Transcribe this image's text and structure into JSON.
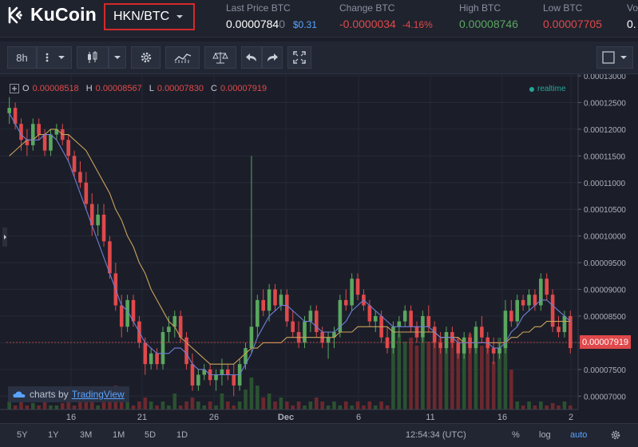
{
  "brand": {
    "name": "KuCoin"
  },
  "market": {
    "pair": "HKN/BTC"
  },
  "stats": {
    "last_price": {
      "label": "Last Price BTC",
      "value": "0.0000784",
      "value_faded": "0",
      "usd": "$0.31"
    },
    "change": {
      "label": "Change BTC",
      "value": "-0.0000034",
      "percent": "-4.16%"
    },
    "high": {
      "label": "High BTC",
      "value": "0.00008746"
    },
    "low": {
      "label": "Low BTC",
      "value": "0.00007705"
    },
    "volume": {
      "label": "Vo",
      "value": "0."
    }
  },
  "toolbar": {
    "interval": "8h"
  },
  "legend": {
    "o_label": "O",
    "o_value": "0.00008518",
    "h_label": "H",
    "h_value": "0.00008567",
    "l_label": "L",
    "l_value": "0.00007830",
    "c_label": "C",
    "c_value": "0.00007919",
    "realtime": "realtime"
  },
  "attribution": {
    "prefix": "charts by",
    "link": "TradingView"
  },
  "bottom": {
    "ranges": [
      "5Y",
      "1Y",
      "3M",
      "1M",
      "5D",
      "1D"
    ],
    "clock": "12:54:34 (UTC)",
    "percent": "%",
    "log": "log",
    "auto": "auto"
  },
  "colors": {
    "up": "#5aa75f",
    "down": "#e0494b",
    "accent": "#5aa3ff",
    "ma_fast": "#6f7fd6",
    "ma_slow": "#c9a25a"
  },
  "chart_data": {
    "type": "candlestick",
    "current_price": "0.00007919",
    "y_ticks": [
      "0.00013000",
      "0.00012500",
      "0.00012000",
      "0.00011500",
      "0.00011000",
      "0.00010500",
      "0.00010000",
      "0.00009500",
      "0.00009000",
      "0.00008500",
      "0.00008000",
      "0.00007500",
      "0.00007000"
    ],
    "ylim": [
      6.75e-05,
      0.0001303
    ],
    "x_ticks": [
      "16",
      "21",
      "26",
      "Dec",
      "6",
      "11",
      "16",
      "2"
    ],
    "candles": [
      [
        12.3,
        12.6,
        12.1,
        12.4
      ],
      [
        12.4,
        12.5,
        12.0,
        12.1
      ],
      [
        12.1,
        12.2,
        11.6,
        11.8
      ],
      [
        11.8,
        12.0,
        11.5,
        11.7
      ],
      [
        11.7,
        12.2,
        11.6,
        12.1
      ],
      [
        12.1,
        12.2,
        11.8,
        11.9
      ],
      [
        11.9,
        12.0,
        11.5,
        11.6
      ],
      [
        11.6,
        12.0,
        11.5,
        11.9
      ],
      [
        11.9,
        12.1,
        11.8,
        12.0
      ],
      [
        12.0,
        12.1,
        11.7,
        11.8
      ],
      [
        11.8,
        11.9,
        11.4,
        11.5
      ],
      [
        11.5,
        11.6,
        11.1,
        11.2
      ],
      [
        11.2,
        11.4,
        10.9,
        11.0
      ],
      [
        11.0,
        11.2,
        10.5,
        10.6
      ],
      [
        10.6,
        10.8,
        10.0,
        10.2
      ],
      [
        10.2,
        10.6,
        10.0,
        10.4
      ],
      [
        10.4,
        10.6,
        9.8,
        9.9
      ],
      [
        9.9,
        10.0,
        9.2,
        9.3
      ],
      [
        9.3,
        9.5,
        8.6,
        8.7
      ],
      [
        8.7,
        8.9,
        8.1,
        8.3
      ],
      [
        8.3,
        8.9,
        8.2,
        8.8
      ],
      [
        8.8,
        8.9,
        8.3,
        8.4
      ],
      [
        8.4,
        8.5,
        7.9,
        8.0
      ],
      [
        8.0,
        8.1,
        7.4,
        7.6
      ],
      [
        7.6,
        7.9,
        7.5,
        7.8
      ],
      [
        7.8,
        7.9,
        7.5,
        7.6
      ],
      [
        7.6,
        8.3,
        7.5,
        8.2
      ],
      [
        8.2,
        8.5,
        8.0,
        8.3
      ],
      [
        8.3,
        8.6,
        8.1,
        8.5
      ],
      [
        8.5,
        8.6,
        8.0,
        8.1
      ],
      [
        8.1,
        8.2,
        7.5,
        7.6
      ],
      [
        7.6,
        7.8,
        7.1,
        7.2
      ],
      [
        7.2,
        7.5,
        7.1,
        7.4
      ],
      [
        7.4,
        7.6,
        7.3,
        7.5
      ],
      [
        7.5,
        7.6,
        7.2,
        7.3
      ],
      [
        7.3,
        7.5,
        7.1,
        7.4
      ],
      [
        7.4,
        7.7,
        7.2,
        7.5
      ],
      [
        7.5,
        7.6,
        7.3,
        7.4
      ],
      [
        7.4,
        7.6,
        7.0,
        7.2
      ],
      [
        7.2,
        7.7,
        7.1,
        7.6
      ],
      [
        7.6,
        8.0,
        7.5,
        7.9
      ],
      [
        7.9,
        11.5,
        7.8,
        8.3
      ],
      [
        8.3,
        8.9,
        8.1,
        8.8
      ],
      [
        8.8,
        9.0,
        8.5,
        8.6
      ],
      [
        8.6,
        9.1,
        8.4,
        9.0
      ],
      [
        9.0,
        9.1,
        8.6,
        8.7
      ],
      [
        8.7,
        9.0,
        8.6,
        8.9
      ],
      [
        8.9,
        9.0,
        8.3,
        8.4
      ],
      [
        8.4,
        8.6,
        8.1,
        8.2
      ],
      [
        8.2,
        8.4,
        7.9,
        8.0
      ],
      [
        8.0,
        8.5,
        7.9,
        8.4
      ],
      [
        8.4,
        8.7,
        8.2,
        8.6
      ],
      [
        8.6,
        8.7,
        8.1,
        8.2
      ],
      [
        8.2,
        8.3,
        7.9,
        8.0
      ],
      [
        8.0,
        8.2,
        7.7,
        8.1
      ],
      [
        8.1,
        8.3,
        7.9,
        8.2
      ],
      [
        8.2,
        8.9,
        8.1,
        8.8
      ],
      [
        8.8,
        9.0,
        8.6,
        8.7
      ],
      [
        8.7,
        9.3,
        8.6,
        9.2
      ],
      [
        9.2,
        9.3,
        8.8,
        8.9
      ],
      [
        8.9,
        9.0,
        8.6,
        8.7
      ],
      [
        8.7,
        8.8,
        8.3,
        8.4
      ],
      [
        8.4,
        8.6,
        8.2,
        8.5
      ],
      [
        8.5,
        8.6,
        8.0,
        8.1
      ],
      [
        8.1,
        8.3,
        7.8,
        7.9
      ],
      [
        7.9,
        8.4,
        7.8,
        8.3
      ],
      [
        8.3,
        8.5,
        8.1,
        8.4
      ],
      [
        8.4,
        8.7,
        8.3,
        8.6
      ],
      [
        8.6,
        8.7,
        8.2,
        8.3
      ],
      [
        8.3,
        8.4,
        8.0,
        8.1
      ],
      [
        8.1,
        8.6,
        8.0,
        8.5
      ],
      [
        8.5,
        8.7,
        8.2,
        8.3
      ],
      [
        8.3,
        8.4,
        7.9,
        8.0
      ],
      [
        8.0,
        8.2,
        7.8,
        7.9
      ],
      [
        7.9,
        8.3,
        7.8,
        8.2
      ],
      [
        8.2,
        8.3,
        7.9,
        8.0
      ],
      [
        8.0,
        8.1,
        7.7,
        7.8
      ],
      [
        7.8,
        8.2,
        7.7,
        8.1
      ],
      [
        8.1,
        8.2,
        7.8,
        7.9
      ],
      [
        7.9,
        8.4,
        7.8,
        8.3
      ],
      [
        8.3,
        8.5,
        8.0,
        8.1
      ],
      [
        8.1,
        8.2,
        7.8,
        7.9
      ],
      [
        7.9,
        8.1,
        7.6,
        7.8
      ],
      [
        7.8,
        8.0,
        7.7,
        7.9
      ],
      [
        7.9,
        8.8,
        7.8,
        8.6
      ],
      [
        8.6,
        8.8,
        8.3,
        8.4
      ],
      [
        8.4,
        8.9,
        8.3,
        8.8
      ],
      [
        8.8,
        8.9,
        8.6,
        8.7
      ],
      [
        8.7,
        9.0,
        8.6,
        8.9
      ],
      [
        8.9,
        9.0,
        8.6,
        8.7
      ],
      [
        8.7,
        9.3,
        8.6,
        9.2
      ],
      [
        9.2,
        9.3,
        8.8,
        8.9
      ],
      [
        8.9,
        9.0,
        8.2,
        8.3
      ],
      [
        8.3,
        8.5,
        8.1,
        8.2
      ],
      [
        8.2,
        8.6,
        8.1,
        8.5
      ],
      [
        8.5,
        8.6,
        7.8,
        7.9
      ]
    ],
    "volume": [
      0.1,
      0.05,
      0.1,
      0.05,
      0.08,
      0.05,
      0.1,
      0.05,
      0.05,
      0.08,
      0.1,
      0.05,
      0.2,
      0.15,
      0.1,
      0.05,
      0.1,
      0.15,
      0.3,
      0.1,
      0.1,
      0.05,
      0.1,
      0.15,
      0.1,
      0.05,
      0.1,
      0.05,
      0.2,
      0.05,
      0.1,
      0.15,
      0.1,
      0.05,
      0.1,
      0.05,
      0.2,
      0.1,
      0.05,
      0.1,
      0.25,
      0.4,
      0.3,
      0.15,
      0.2,
      0.1,
      0.15,
      0.1,
      0.05,
      0.1,
      0.05,
      0.1,
      0.15,
      0.1,
      0.05,
      0.1,
      0.05,
      0.1,
      0.05,
      0.1,
      0.05,
      0.1,
      0.05,
      0.1,
      0.05,
      0.9,
      0.95,
      0.85,
      0.9,
      0.8,
      0.9,
      0.85,
      0.95,
      0.9,
      0.8,
      0.85,
      0.9,
      0.8,
      0.95,
      0.9,
      0.8,
      0.85,
      0.6,
      0.9,
      0.85,
      0.5,
      0.1,
      0.05,
      0.1,
      0.05,
      0.1,
      0.05,
      0.08,
      0.05,
      0.1,
      0.05
    ],
    "ma_fast": [
      12.3,
      12.1,
      11.9,
      11.8,
      11.8,
      11.8,
      11.9,
      11.9,
      11.8,
      11.6,
      11.4,
      11.1,
      10.8,
      10.5,
      10.2,
      9.9,
      9.6,
      9.3,
      9.0,
      8.7,
      8.6,
      8.4,
      8.2,
      8.0,
      7.9,
      7.8,
      7.8,
      7.8,
      7.9,
      7.9,
      7.8,
      7.6,
      7.5,
      7.5,
      7.4,
      7.4,
      7.4,
      7.4,
      7.4,
      7.4,
      7.6,
      7.8,
      8.1,
      8.3,
      8.5,
      8.6,
      8.7,
      8.7,
      8.6,
      8.5,
      8.4,
      8.4,
      8.3,
      8.2,
      8.2,
      8.2,
      8.3,
      8.4,
      8.6,
      8.7,
      8.8,
      8.7,
      8.6,
      8.5,
      8.4,
      8.3,
      8.3,
      8.3,
      8.3,
      8.3,
      8.3,
      8.3,
      8.2,
      8.1,
      8.1,
      8.1,
      8.0,
      8.0,
      8.0,
      8.0,
      8.0,
      8.0,
      7.9,
      7.9,
      8.0,
      8.2,
      8.3,
      8.5,
      8.6,
      8.7,
      8.8,
      8.8,
      8.7,
      8.6,
      8.5,
      8.4
    ],
    "ma_slow": [
      11.5,
      11.6,
      11.7,
      11.8,
      11.8,
      11.9,
      11.9,
      12.0,
      12.0,
      11.9,
      11.9,
      11.8,
      11.7,
      11.6,
      11.4,
      11.2,
      11.0,
      10.8,
      10.5,
      10.3,
      10.0,
      9.8,
      9.5,
      9.3,
      9.0,
      8.8,
      8.6,
      8.4,
      8.3,
      8.1,
      8.0,
      7.9,
      7.8,
      7.7,
      7.6,
      7.6,
      7.6,
      7.6,
      7.6,
      7.7,
      7.8,
      7.9,
      7.9,
      8.0,
      8.0,
      8.0,
      8.0,
      8.1,
      8.1,
      8.1,
      8.1,
      8.1,
      8.1,
      8.1,
      8.1,
      8.1,
      8.2,
      8.2,
      8.2,
      8.3,
      8.3,
      8.3,
      8.3,
      8.3,
      8.3,
      8.2,
      8.2,
      8.2,
      8.2,
      8.2,
      8.2,
      8.2,
      8.2,
      8.1,
      8.1,
      8.1,
      8.1,
      8.0,
      8.0,
      8.0,
      8.0,
      8.0,
      8.0,
      8.0,
      8.0,
      8.1,
      8.1,
      8.2,
      8.2,
      8.3,
      8.3,
      8.4,
      8.4,
      8.4,
      8.4,
      8.4
    ]
  }
}
